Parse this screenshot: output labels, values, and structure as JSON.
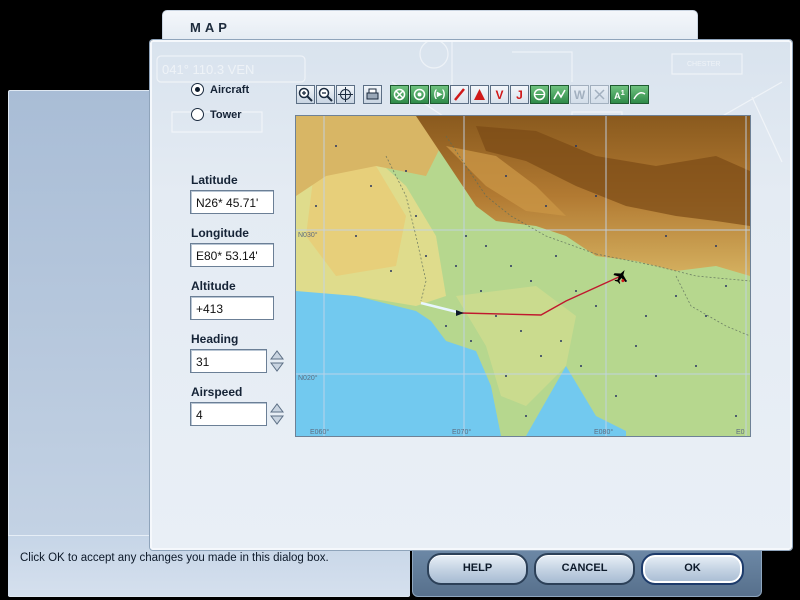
{
  "dialog": {
    "title": "MAP"
  },
  "view_mode": {
    "aircraft_label": "Aircraft",
    "tower_label": "Tower",
    "selected": "Aircraft"
  },
  "fields": {
    "latitude_label": "Latitude",
    "latitude_value": "N26* 45.71'",
    "longitude_label": "Longitude",
    "longitude_value": "E80* 53.14'",
    "altitude_label": "Altitude",
    "altitude_value": "+413",
    "heading_label": "Heading",
    "heading_value": "31",
    "airspeed_label": "Airspeed",
    "airspeed_value": "4"
  },
  "toolbar": {
    "icons": [
      "zoom-in-icon",
      "zoom-out-icon",
      "center-aircraft-icon",
      "print-icon",
      "vor-icon",
      "ndb-icon",
      "ils-icon",
      "airport-icon",
      "intersection-icon",
      "victor-airway-icon",
      "jet-airway-icon",
      "gps-icon",
      "route-icon",
      "weather-icon",
      "airspace-icon",
      "terrain-icon"
    ]
  },
  "map": {
    "lat_labels": [
      "N030°",
      "N020°"
    ],
    "lon_labels": [
      "E060°",
      "E070°",
      "E080°",
      "E0"
    ],
    "aircraft_color": "#d01818",
    "route_color": "#c0182e"
  },
  "background_deco": {
    "text1": "041° 110.3 VEN",
    "text2": "CHESTER"
  },
  "status": {
    "text": "Click OK to accept any changes you made in this dialog box."
  },
  "buttons": {
    "help": "HELP",
    "cancel": "CANCEL",
    "ok": "OK"
  }
}
